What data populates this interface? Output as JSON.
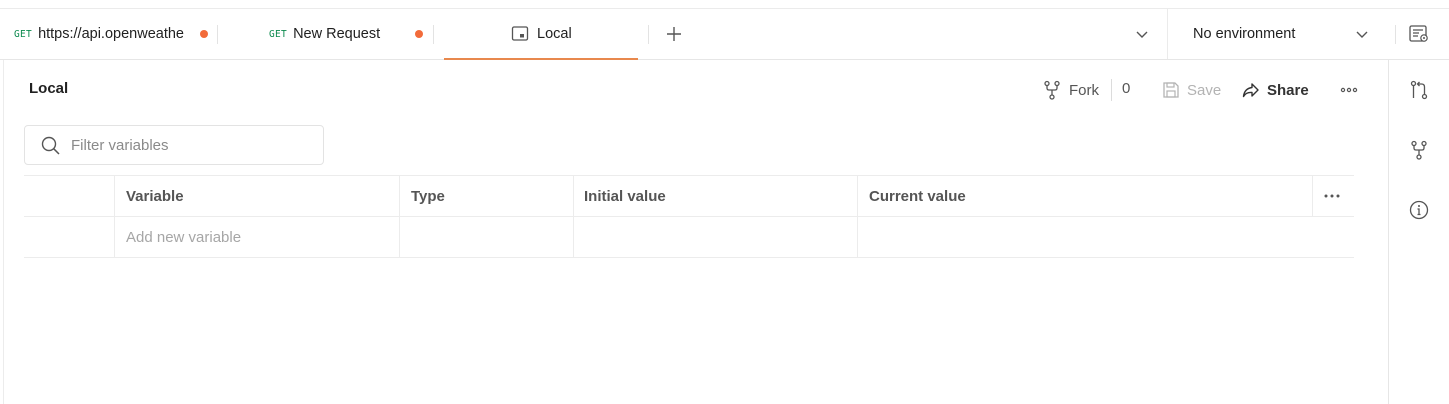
{
  "tabs": [
    {
      "method": "GET",
      "label": "https://api.openweathe",
      "unsaved": true
    },
    {
      "method": "GET",
      "label": "New Request",
      "unsaved": true
    },
    {
      "label": "Local",
      "active": true,
      "icon": "environment-icon"
    }
  ],
  "environment": {
    "selected": "No environment"
  },
  "page": {
    "title": "Local"
  },
  "actions": {
    "fork_label": "Fork",
    "fork_count": "0",
    "save_label": "Save",
    "share_label": "Share"
  },
  "filter": {
    "placeholder": "Filter variables",
    "value": ""
  },
  "table": {
    "columns": [
      "Variable",
      "Type",
      "Initial value",
      "Current value"
    ],
    "new_row_placeholder": "Add new variable"
  },
  "colors": {
    "accent": "#e8884d",
    "unsaved_dot": "#f26b3a",
    "get_method": "#0c8a4e"
  },
  "rail": {
    "icons": [
      "pull-request-icon",
      "fork-icon",
      "info-icon"
    ]
  }
}
